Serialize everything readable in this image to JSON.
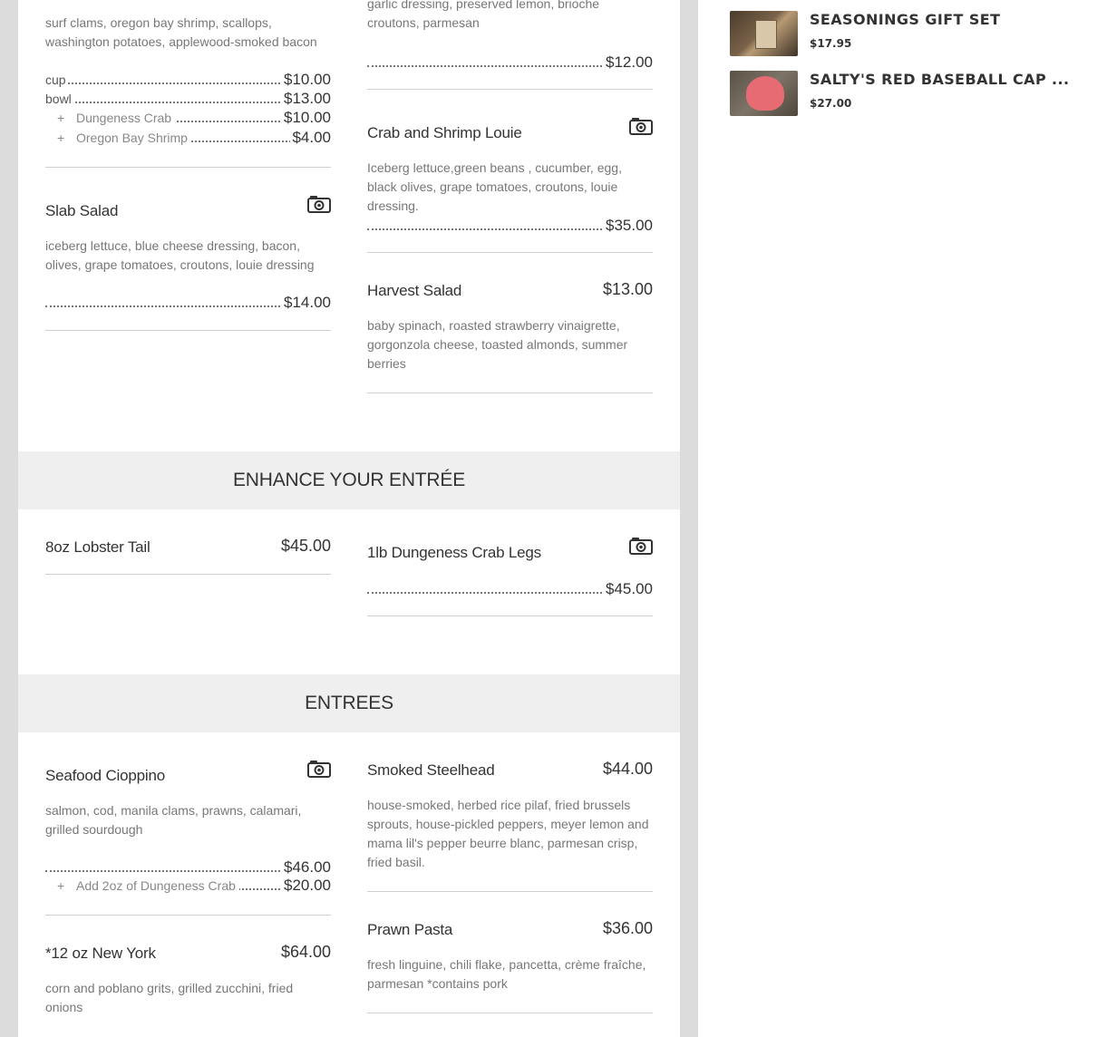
{
  "menu": {
    "col1": {
      "chowder": {
        "desc": "surf clams, oregon bay shrimp, scallops, washington potatoes, applewood-smoked bacon",
        "cup_label": "cup",
        "cup_price": "$10.00",
        "bowl_label": "bowl",
        "bowl_price": "$13.00",
        "addon1_label": "Dungeness Crab",
        "addon1_price": "$10.00",
        "addon2_label": "Oregon Bay Shrimp",
        "addon2_price": "$4.00"
      },
      "slab_salad": {
        "name": "Slab Salad",
        "desc": "iceberg lettuce, blue cheese dressing, bacon, olives, grape tomatoes, croutons, louie dressing",
        "price": "$14.00"
      }
    },
    "col2": {
      "caesar": {
        "desc": "garlic dressing, preserved lemon, brioche croutons, parmesan",
        "price": "$12.00"
      },
      "louie": {
        "name": "Crab and Shrimp Louie",
        "desc": "Iceberg lettuce,green beans , cucumber, egg, black olives, grape tomatoes, croutons, louie dressing.",
        "price": "$35.00"
      },
      "harvest": {
        "name": "Harvest Salad",
        "price": "$13.00",
        "desc": "baby spinach, roasted strawberry vinaigrette, gorgonzola cheese, toasted almonds, summer berries"
      }
    },
    "enhance": {
      "heading": "ENHANCE YOUR ENTRÉE",
      "lobster": {
        "name": "8oz Lobster Tail",
        "price": "$45.00"
      },
      "crab_legs": {
        "name": "1lb Dungeness Crab Legs",
        "price": "$45.00"
      }
    },
    "entrees": {
      "heading": "ENTREES",
      "cioppino": {
        "name": "Seafood Cioppino",
        "desc": "salmon, cod, manila clams, prawns, calamari, grilled sourdough",
        "price": "$46.00",
        "addon_label": "Add 2oz of Dungeness Crab",
        "addon_price": "$20.00"
      },
      "steelhead": {
        "name": "Smoked Steelhead",
        "price": "$44.00",
        "desc": "house-smoked, herbed rice pilaf, fried brussels sprouts, house-pickled peppers, meyer lemon and mama lil's pepper beurre blanc, parmesan crisp, fried basil."
      },
      "new_york": {
        "name": "*12 oz New York",
        "price": "$64.00",
        "desc": "corn and poblano grits, grilled zucchini, fried onions"
      },
      "prawn_pasta": {
        "name": "Prawn Pasta",
        "price": "$36.00",
        "desc": "fresh linguine, chili flake, pancetta, crème fraîche, parmesan *contains pork"
      }
    },
    "plus_symbol": "+"
  },
  "sidebar": {
    "products": [
      {
        "title": "SEASONINGS GIFT SET",
        "price": "$17.95",
        "thumb": "seasonings-gift-set-thumbnail"
      },
      {
        "title": "SALTY'S RED BASEBALL CAP ...",
        "price": "$27.00",
        "thumb": "red-baseball-cap-thumbnail"
      }
    ]
  },
  "icons": {
    "photo": "camera-icon"
  }
}
